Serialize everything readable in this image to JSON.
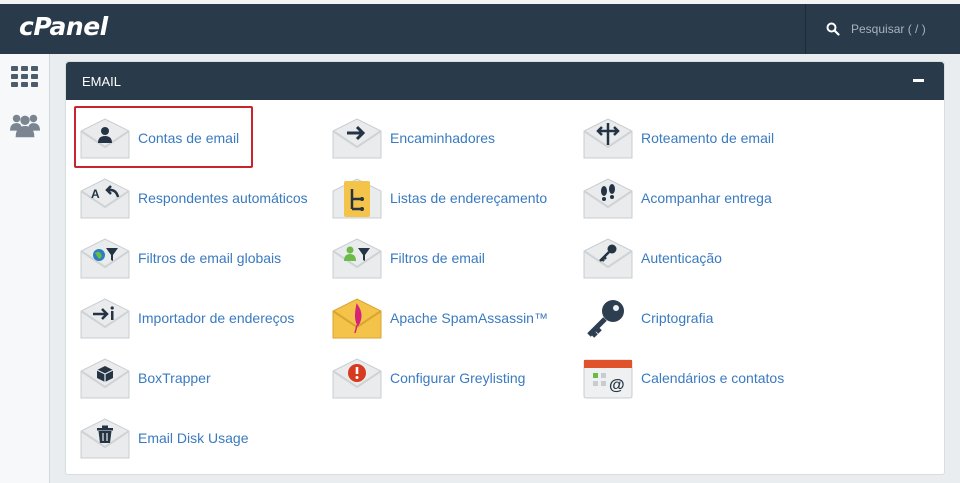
{
  "header": {
    "logo": "cPanel",
    "search_placeholder": "Pesquisar ( / )"
  },
  "sidebar": {
    "items": [
      {
        "icon": "grid-icon"
      },
      {
        "icon": "users-icon"
      }
    ]
  },
  "section": {
    "title": "EMAIL",
    "items": [
      {
        "label": "Contas de email",
        "icon": "email-accounts-icon"
      },
      {
        "label": "Encaminhadores",
        "icon": "forwarders-icon"
      },
      {
        "label": "Roteamento de email",
        "icon": "email-routing-icon"
      },
      {
        "label": "Respondentes automáticos",
        "icon": "autoresponders-icon"
      },
      {
        "label": "Listas de endereçamento",
        "icon": "mailing-lists-icon"
      },
      {
        "label": "Acompanhar entrega",
        "icon": "track-delivery-icon"
      },
      {
        "label": "Filtros de email globais",
        "icon": "global-email-filters-icon"
      },
      {
        "label": "Filtros de email",
        "icon": "email-filters-icon"
      },
      {
        "label": "Autenticação",
        "icon": "authentication-icon"
      },
      {
        "label": "Importador de endereços",
        "icon": "address-importer-icon"
      },
      {
        "label": "Apache SpamAssassin™",
        "icon": "spamassassin-icon"
      },
      {
        "label": "Criptografia",
        "icon": "encryption-key-icon"
      },
      {
        "label": "BoxTrapper",
        "icon": "boxtrapper-icon"
      },
      {
        "label": "Configurar Greylisting",
        "icon": "greylisting-icon"
      },
      {
        "label": "Calendários e contatos",
        "icon": "calendars-contacts-icon"
      },
      {
        "label": "Email Disk Usage",
        "icon": "email-disk-usage-icon"
      }
    ]
  }
}
